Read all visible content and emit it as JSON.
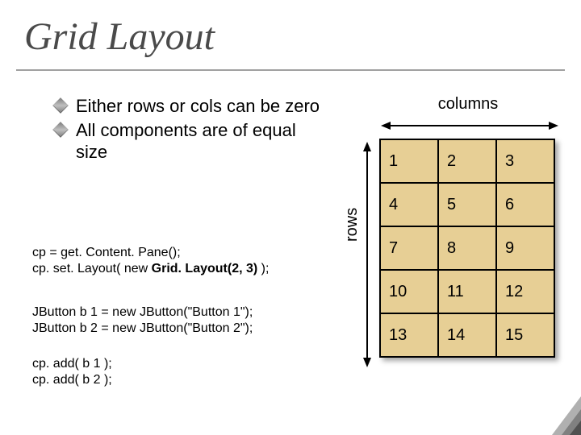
{
  "title": "Grid Layout",
  "bullets": {
    "b1": "Either rows or cols can be zero",
    "b2": "All components are of equal size"
  },
  "code": {
    "line1a": "cp = get. Content. Pane();",
    "line1b_pre": "cp. set. Layout( new ",
    "line1b_bold": "Grid. Layout(2, 3)",
    "line1b_post": " );",
    "line2a": "JButton b 1 = new JButton(\"Button 1\");",
    "line2b": "JButton b 2 = new JButton(\"Button 2\");",
    "line3a": "cp. add( b 1 );",
    "line3b": "cp. add( b 2 );"
  },
  "labels": {
    "columns": "columns",
    "rows": "rows"
  },
  "grid": {
    "r0c0": "1",
    "r0c1": "2",
    "r0c2": "3",
    "r1c0": "4",
    "r1c1": "5",
    "r1c2": "6",
    "r2c0": "7",
    "r2c1": "8",
    "r2c2": "9",
    "r3c0": "10",
    "r3c1": "11",
    "r3c2": "12",
    "r4c0": "13",
    "r4c1": "14",
    "r4c2": "15"
  }
}
